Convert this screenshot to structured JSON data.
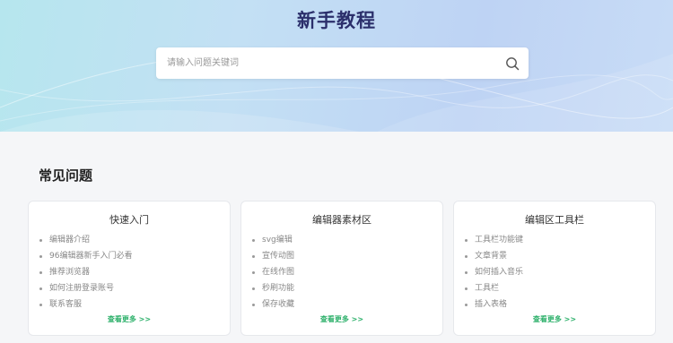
{
  "hero": {
    "title": "新手教程",
    "search": {
      "placeholder": "请输入问题关键词",
      "value": ""
    }
  },
  "faq": {
    "title": "常见问题",
    "more_label": "查看更多 >>",
    "cards": [
      {
        "title": "快速入门",
        "items": [
          "编辑器介绍",
          "96编辑器新手入门必看",
          "推荐浏览器",
          "如何注册登录账号",
          "联系客服"
        ]
      },
      {
        "title": "编辑器素材区",
        "items": [
          "svg编辑",
          "宣传动图",
          "在线作图",
          "秒刷功能",
          "保存收藏"
        ]
      },
      {
        "title": "编辑区工具栏",
        "items": [
          "工具栏功能键",
          "文章背景",
          "如何插入音乐",
          "工具栏",
          "插入表格"
        ]
      }
    ]
  },
  "colors": {
    "accent": "#2cb06a",
    "title": "#2b2f6b"
  }
}
